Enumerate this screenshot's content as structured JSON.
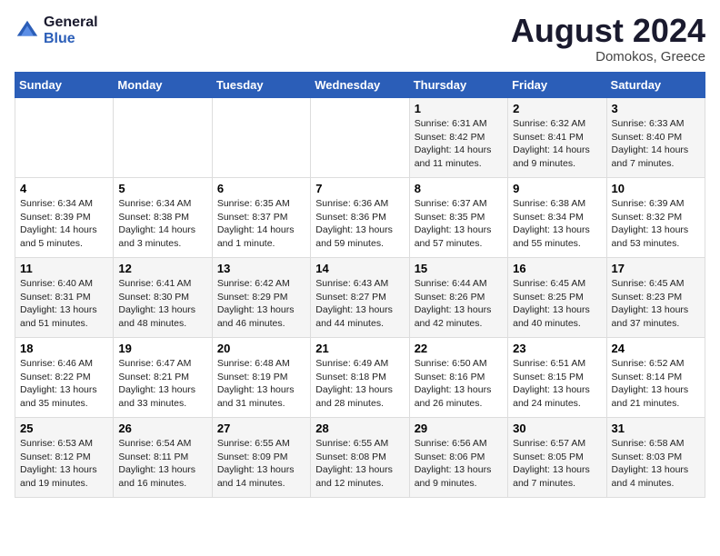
{
  "logo": {
    "line1": "General",
    "line2": "Blue"
  },
  "title": "August 2024",
  "location": "Domokos, Greece",
  "weekdays": [
    "Sunday",
    "Monday",
    "Tuesday",
    "Wednesday",
    "Thursday",
    "Friday",
    "Saturday"
  ],
  "weeks": [
    [
      {
        "day": "",
        "info": ""
      },
      {
        "day": "",
        "info": ""
      },
      {
        "day": "",
        "info": ""
      },
      {
        "day": "",
        "info": ""
      },
      {
        "day": "1",
        "info": "Sunrise: 6:31 AM\nSunset: 8:42 PM\nDaylight: 14 hours\nand 11 minutes."
      },
      {
        "day": "2",
        "info": "Sunrise: 6:32 AM\nSunset: 8:41 PM\nDaylight: 14 hours\nand 9 minutes."
      },
      {
        "day": "3",
        "info": "Sunrise: 6:33 AM\nSunset: 8:40 PM\nDaylight: 14 hours\nand 7 minutes."
      }
    ],
    [
      {
        "day": "4",
        "info": "Sunrise: 6:34 AM\nSunset: 8:39 PM\nDaylight: 14 hours\nand 5 minutes."
      },
      {
        "day": "5",
        "info": "Sunrise: 6:34 AM\nSunset: 8:38 PM\nDaylight: 14 hours\nand 3 minutes."
      },
      {
        "day": "6",
        "info": "Sunrise: 6:35 AM\nSunset: 8:37 PM\nDaylight: 14 hours\nand 1 minute."
      },
      {
        "day": "7",
        "info": "Sunrise: 6:36 AM\nSunset: 8:36 PM\nDaylight: 13 hours\nand 59 minutes."
      },
      {
        "day": "8",
        "info": "Sunrise: 6:37 AM\nSunset: 8:35 PM\nDaylight: 13 hours\nand 57 minutes."
      },
      {
        "day": "9",
        "info": "Sunrise: 6:38 AM\nSunset: 8:34 PM\nDaylight: 13 hours\nand 55 minutes."
      },
      {
        "day": "10",
        "info": "Sunrise: 6:39 AM\nSunset: 8:32 PM\nDaylight: 13 hours\nand 53 minutes."
      }
    ],
    [
      {
        "day": "11",
        "info": "Sunrise: 6:40 AM\nSunset: 8:31 PM\nDaylight: 13 hours\nand 51 minutes."
      },
      {
        "day": "12",
        "info": "Sunrise: 6:41 AM\nSunset: 8:30 PM\nDaylight: 13 hours\nand 48 minutes."
      },
      {
        "day": "13",
        "info": "Sunrise: 6:42 AM\nSunset: 8:29 PM\nDaylight: 13 hours\nand 46 minutes."
      },
      {
        "day": "14",
        "info": "Sunrise: 6:43 AM\nSunset: 8:27 PM\nDaylight: 13 hours\nand 44 minutes."
      },
      {
        "day": "15",
        "info": "Sunrise: 6:44 AM\nSunset: 8:26 PM\nDaylight: 13 hours\nand 42 minutes."
      },
      {
        "day": "16",
        "info": "Sunrise: 6:45 AM\nSunset: 8:25 PM\nDaylight: 13 hours\nand 40 minutes."
      },
      {
        "day": "17",
        "info": "Sunrise: 6:45 AM\nSunset: 8:23 PM\nDaylight: 13 hours\nand 37 minutes."
      }
    ],
    [
      {
        "day": "18",
        "info": "Sunrise: 6:46 AM\nSunset: 8:22 PM\nDaylight: 13 hours\nand 35 minutes."
      },
      {
        "day": "19",
        "info": "Sunrise: 6:47 AM\nSunset: 8:21 PM\nDaylight: 13 hours\nand 33 minutes."
      },
      {
        "day": "20",
        "info": "Sunrise: 6:48 AM\nSunset: 8:19 PM\nDaylight: 13 hours\nand 31 minutes."
      },
      {
        "day": "21",
        "info": "Sunrise: 6:49 AM\nSunset: 8:18 PM\nDaylight: 13 hours\nand 28 minutes."
      },
      {
        "day": "22",
        "info": "Sunrise: 6:50 AM\nSunset: 8:16 PM\nDaylight: 13 hours\nand 26 minutes."
      },
      {
        "day": "23",
        "info": "Sunrise: 6:51 AM\nSunset: 8:15 PM\nDaylight: 13 hours\nand 24 minutes."
      },
      {
        "day": "24",
        "info": "Sunrise: 6:52 AM\nSunset: 8:14 PM\nDaylight: 13 hours\nand 21 minutes."
      }
    ],
    [
      {
        "day": "25",
        "info": "Sunrise: 6:53 AM\nSunset: 8:12 PM\nDaylight: 13 hours\nand 19 minutes."
      },
      {
        "day": "26",
        "info": "Sunrise: 6:54 AM\nSunset: 8:11 PM\nDaylight: 13 hours\nand 16 minutes."
      },
      {
        "day": "27",
        "info": "Sunrise: 6:55 AM\nSunset: 8:09 PM\nDaylight: 13 hours\nand 14 minutes."
      },
      {
        "day": "28",
        "info": "Sunrise: 6:55 AM\nSunset: 8:08 PM\nDaylight: 13 hours\nand 12 minutes."
      },
      {
        "day": "29",
        "info": "Sunrise: 6:56 AM\nSunset: 8:06 PM\nDaylight: 13 hours\nand 9 minutes."
      },
      {
        "day": "30",
        "info": "Sunrise: 6:57 AM\nSunset: 8:05 PM\nDaylight: 13 hours\nand 7 minutes."
      },
      {
        "day": "31",
        "info": "Sunrise: 6:58 AM\nSunset: 8:03 PM\nDaylight: 13 hours\nand 4 minutes."
      }
    ]
  ]
}
